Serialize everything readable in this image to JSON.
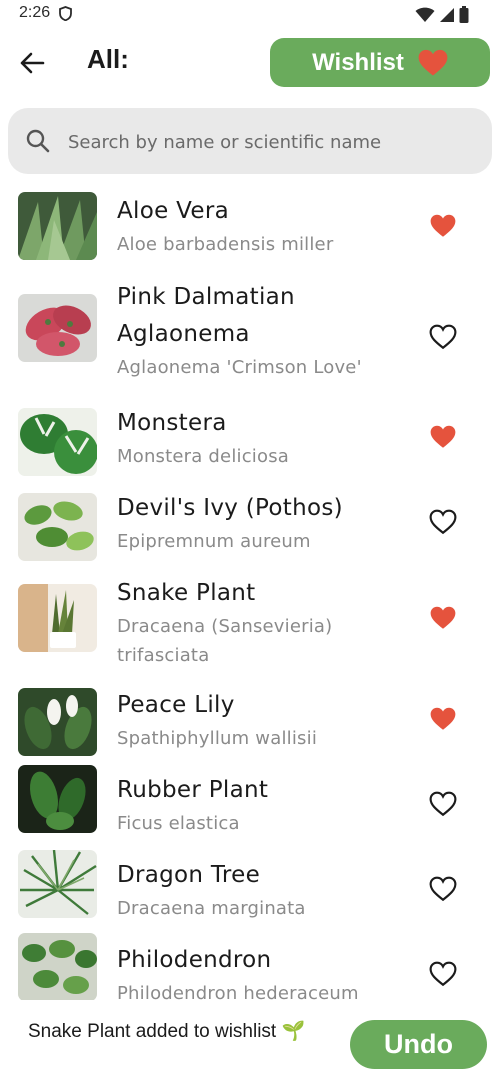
{
  "status": {
    "time": "2:26"
  },
  "header": {
    "title": "All:",
    "wishlist_label": "Wishlist"
  },
  "search": {
    "placeholder": "Search by name or scientific name"
  },
  "plants": [
    {
      "name_lines": [
        "Aloe Vera"
      ],
      "sci_lines": [
        "Aloe barbadensis miller"
      ],
      "wishlisted": true
    },
    {
      "name_lines": [
        "Pink Dalmatian",
        "Aglaonema"
      ],
      "sci_lines": [
        "Aglaonema 'Crimson Love'"
      ],
      "wishlisted": false
    },
    {
      "name_lines": [
        "Monstera"
      ],
      "sci_lines": [
        "Monstera deliciosa"
      ],
      "wishlisted": true
    },
    {
      "name_lines": [
        "Devil's Ivy (Pothos)"
      ],
      "sci_lines": [
        "Epipremnum aureum"
      ],
      "wishlisted": false
    },
    {
      "name_lines": [
        "Snake Plant"
      ],
      "sci_lines": [
        "Dracaena (Sansevieria)",
        "trifasciata"
      ],
      "wishlisted": true
    },
    {
      "name_lines": [
        "Peace Lily"
      ],
      "sci_lines": [
        "Spathiphyllum wallisii"
      ],
      "wishlisted": true
    },
    {
      "name_lines": [
        "Rubber Plant"
      ],
      "sci_lines": [
        "Ficus elastica"
      ],
      "wishlisted": false
    },
    {
      "name_lines": [
        "Dragon Tree"
      ],
      "sci_lines": [
        "Dracaena marginata"
      ],
      "wishlisted": false
    },
    {
      "name_lines": [
        "Philodendron"
      ],
      "sci_lines": [
        "Philodendron hederaceum"
      ],
      "wishlisted": false
    }
  ],
  "snackbar": {
    "message": "Snake Plant added to wishlist 🌱",
    "action_label": "Undo"
  },
  "colors": {
    "accent_green": "#6aab5c",
    "heart_red": "#e5533d",
    "text_muted": "#8a8a8a"
  },
  "icons": {
    "back": "arrow-left-icon",
    "search": "search-icon",
    "wishlisted": "heart-filled-icon",
    "not_wishlisted": "heart-outline-icon"
  }
}
